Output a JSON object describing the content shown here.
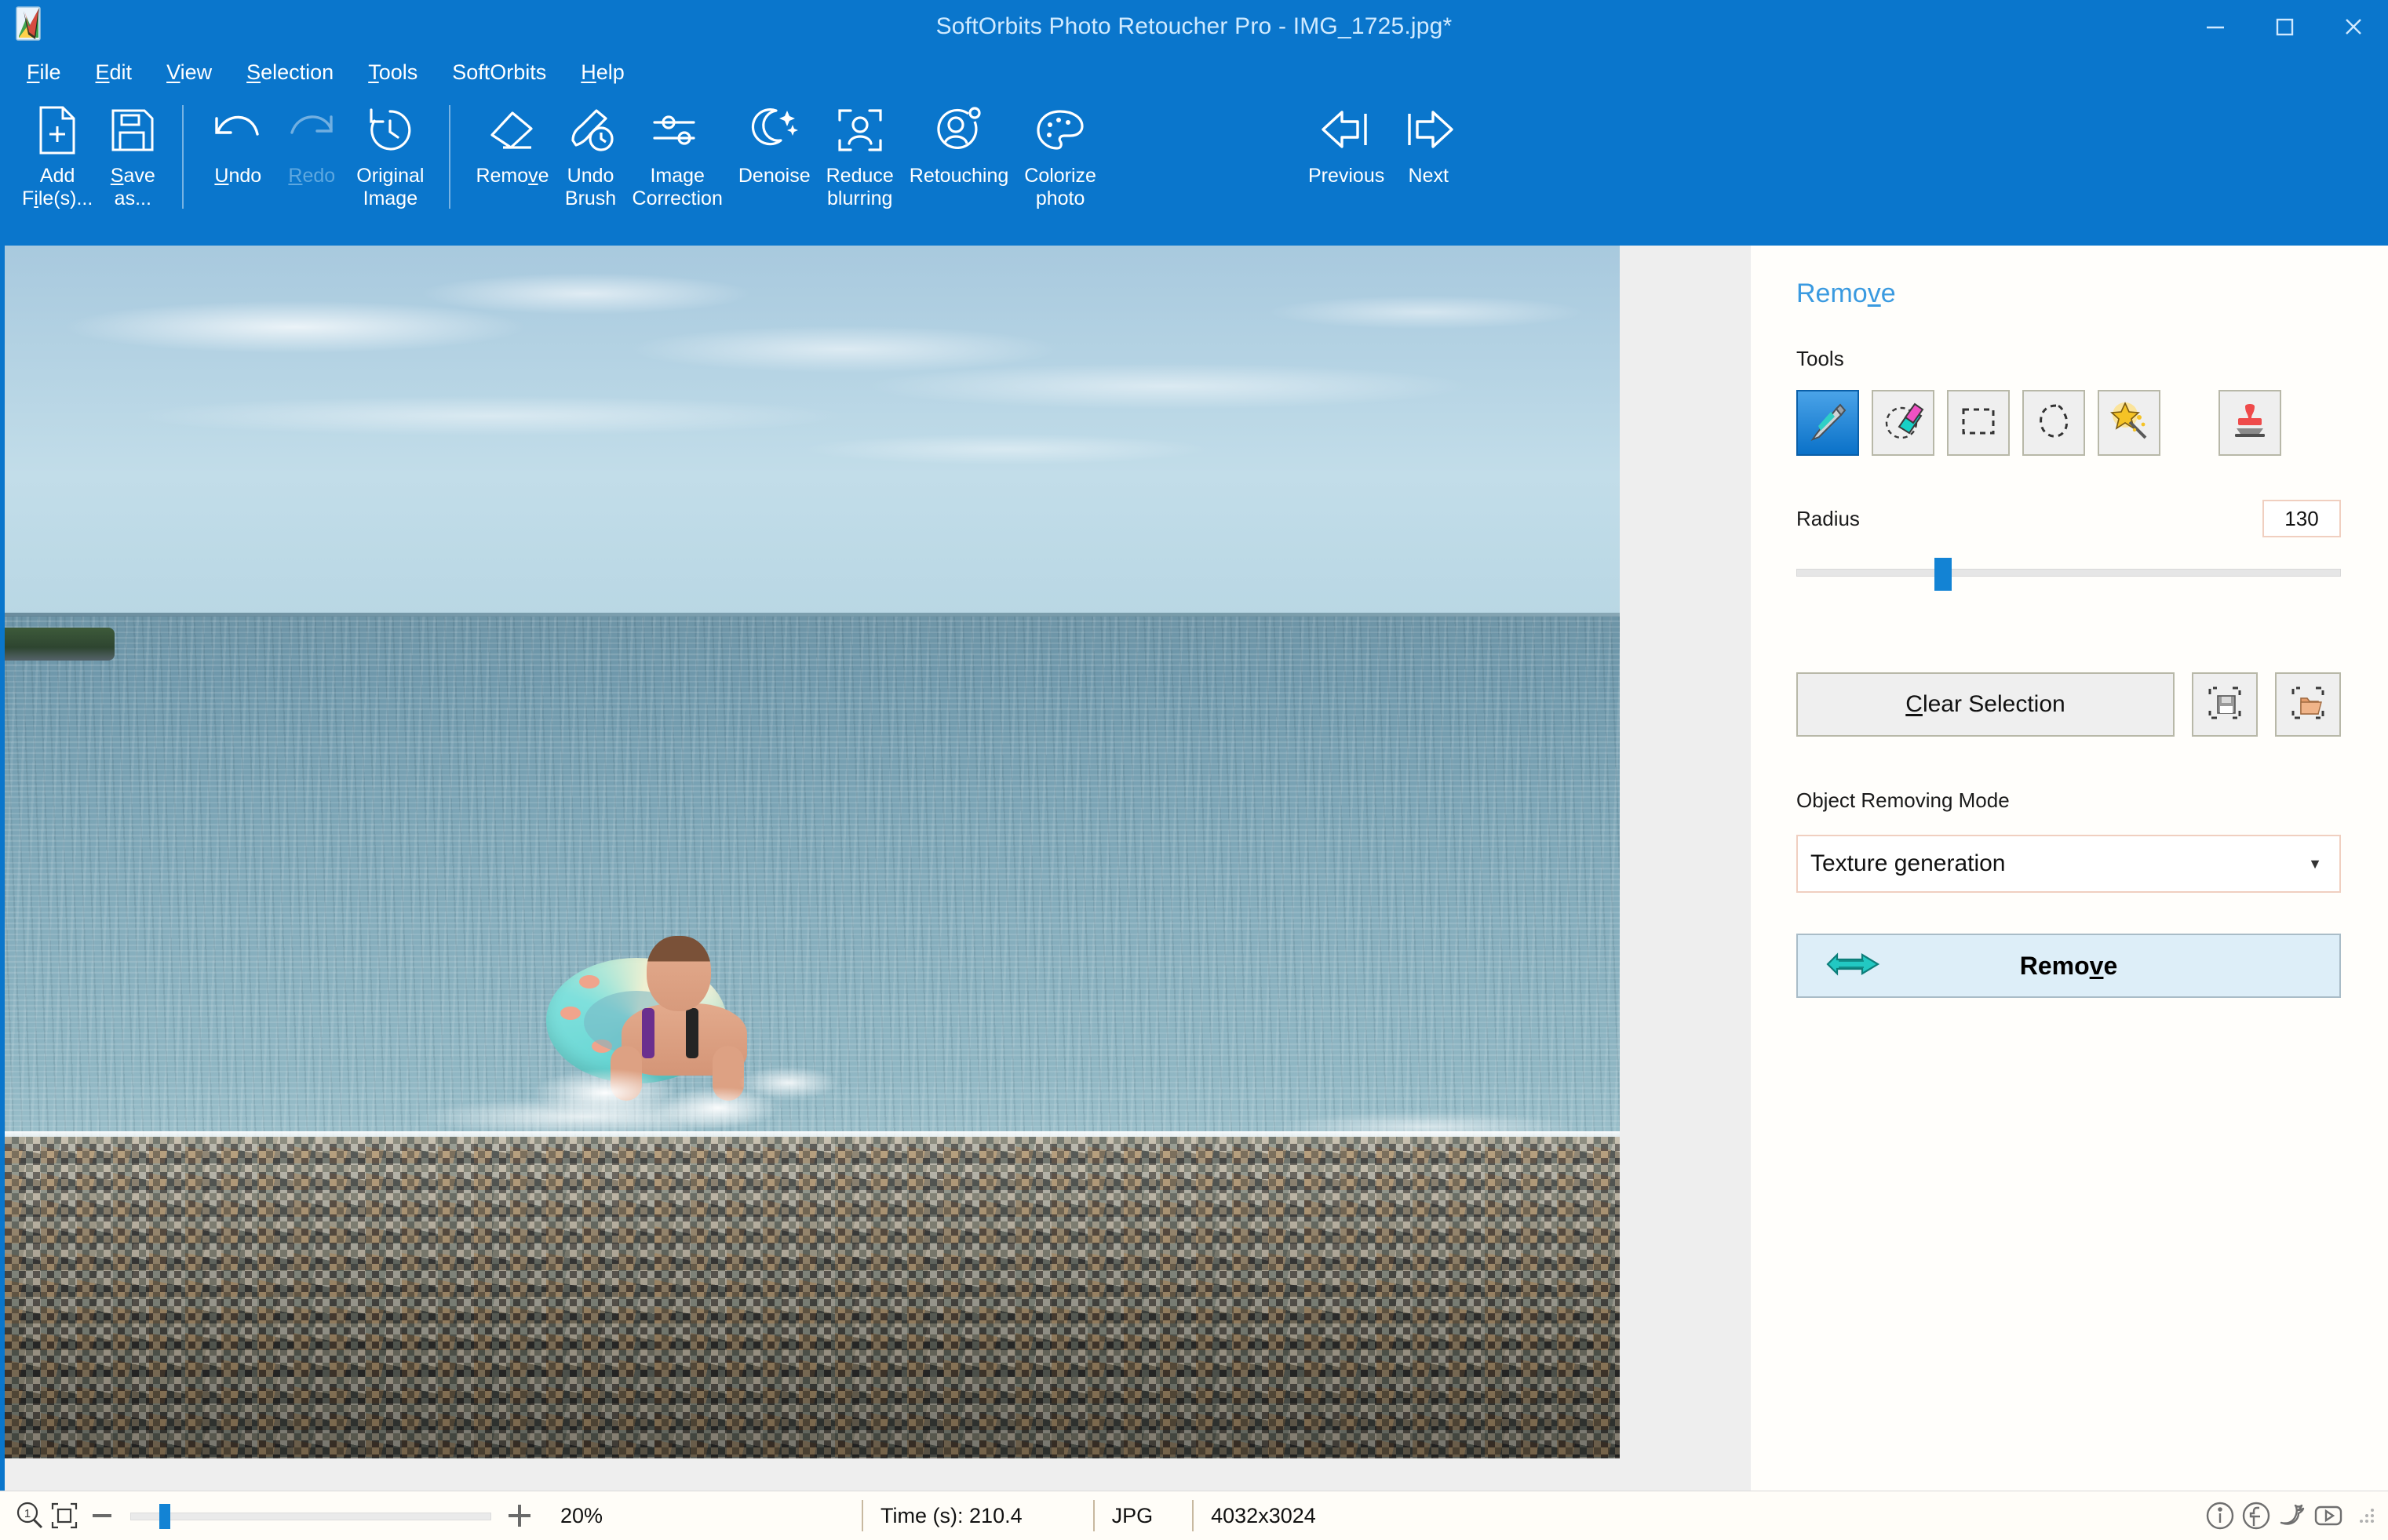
{
  "window": {
    "title": "SoftOrbits Photo Retoucher Pro - IMG_1725.jpg*",
    "logo_icon": "app-logo-icon",
    "minimize_icon": "minimize-icon",
    "maximize_icon": "maximize-icon",
    "close_icon": "close-icon",
    "accent_color": "#0a76cc"
  },
  "menubar": {
    "items": [
      {
        "label": "File",
        "accel": "F"
      },
      {
        "label": "Edit",
        "accel": "E"
      },
      {
        "label": "View",
        "accel": "V"
      },
      {
        "label": "Selection",
        "accel": "S"
      },
      {
        "label": "Tools",
        "accel": "T"
      },
      {
        "label": "SoftOrbits",
        "accel": ""
      },
      {
        "label": "Help",
        "accel": "H"
      }
    ]
  },
  "ribbon": {
    "groups": [
      {
        "buttons": [
          {
            "label": "Add\nFile(s)...",
            "icon": "add-file-icon",
            "disabled": false
          },
          {
            "label": "Save\nas...",
            "icon": "save-as-icon",
            "disabled": false
          }
        ]
      },
      {
        "buttons": [
          {
            "label": "Undo",
            "icon": "undo-icon",
            "disabled": false
          },
          {
            "label": "Redo",
            "icon": "redo-icon",
            "disabled": true
          },
          {
            "label": "Original\nImage",
            "icon": "original-image-icon",
            "disabled": false
          }
        ]
      },
      {
        "buttons": [
          {
            "label": "Remove",
            "icon": "eraser-icon",
            "disabled": false
          },
          {
            "label": "Undo\nBrush",
            "icon": "undo-brush-icon",
            "disabled": false
          },
          {
            "label": "Image\nCorrection",
            "icon": "sliders-icon",
            "disabled": false
          },
          {
            "label": "Denoise",
            "icon": "moon-stars-icon",
            "disabled": false
          },
          {
            "label": "Reduce\nblurring",
            "icon": "focus-person-icon",
            "disabled": false
          },
          {
            "label": "Retouching",
            "icon": "person-gear-icon",
            "disabled": false
          },
          {
            "label": "Colorize\nphoto",
            "icon": "palette-icon",
            "disabled": false
          }
        ]
      },
      {
        "buttons": [
          {
            "label": "Previous",
            "icon": "arrow-left-icon",
            "disabled": false
          },
          {
            "label": "Next",
            "icon": "arrow-right-icon",
            "disabled": false
          }
        ]
      }
    ]
  },
  "canvas": {
    "photo_description": "Beach photo: overcast sky, sea, girl on turquoise inflatable ring in breaking wave, pebble beach foreground",
    "background_color": "#eeeeee"
  },
  "panel": {
    "title": "Remove",
    "title_accel": "v",
    "tools_label": "Tools",
    "tools": [
      {
        "name": "marker-tool",
        "icon": "marker-icon",
        "selected": true
      },
      {
        "name": "eraser-tool",
        "icon": "eraser-tool-icon",
        "selected": false
      },
      {
        "name": "rectangle-select-tool",
        "icon": "rectangle-select-icon",
        "selected": false
      },
      {
        "name": "lasso-tool",
        "icon": "lasso-icon",
        "selected": false
      },
      {
        "name": "magic-wand-tool",
        "icon": "magic-wand-icon",
        "selected": false
      },
      {
        "name": "stamp-tool",
        "icon": "stamp-icon",
        "selected": false
      }
    ],
    "radius_label": "Radius",
    "radius_value": "130",
    "radius_slider_percent": 27,
    "clear_selection_label": "Clear Selection",
    "clear_selection_accel": "C",
    "save_selection_icon": "save-selection-icon",
    "load_selection_icon": "load-selection-icon",
    "mode_label": "Object Removing Mode",
    "mode_value": "Texture generation",
    "mode_caret": "▼",
    "remove_label": "Remove",
    "remove_accel": "v",
    "remove_icon": "arrow-right-thick-icon",
    "accent_color": "#3a9ae0"
  },
  "statusbar": {
    "zoom_one_to_one_icon": "zoom-actual-size-icon",
    "fit_to_window_icon": "fit-to-window-icon",
    "minus_icon": "zoom-out-icon",
    "plus_icon": "zoom-in-icon",
    "zoom_slider_percent": 5,
    "zoom_percent": "20%",
    "time_label": "Time (s): 210.4",
    "format_label": "JPG",
    "dimensions_label": "4032x3024",
    "info_icon": "info-icon",
    "facebook_icon": "facebook-icon",
    "twitter_icon": "twitter-icon",
    "youtube_icon": "youtube-icon",
    "resize_grip_icon": "resize-grip-icon"
  }
}
